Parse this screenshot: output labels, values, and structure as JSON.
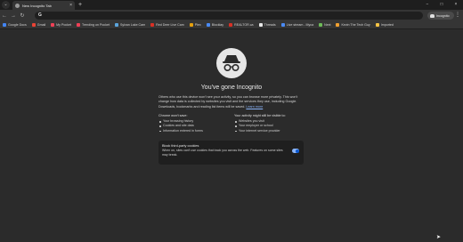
{
  "tabstrip": {
    "search_icon": "search-icon",
    "active_tab": {
      "title": "New Incognito Tab",
      "close": "×"
    },
    "new_tab": "+",
    "window_controls": [
      "−",
      "□",
      "×"
    ]
  },
  "toolbar": {
    "back": "←",
    "forward": "→",
    "reload": "↻",
    "omnibox": {
      "logo": "G",
      "value": ""
    },
    "profile_label": "Incognito",
    "menu": "⋮"
  },
  "bookmarks": [
    {
      "label": "Google Docs",
      "color": "#4285f4"
    },
    {
      "label": "Gmail",
      "color": "#ea4335"
    },
    {
      "label": "My Pocket",
      "color": "#ef4056"
    },
    {
      "label": "Trending on Pocket",
      "color": "#ef4056"
    },
    {
      "label": "Sylvan Lake Cam",
      "color": "#5ba5dd"
    },
    {
      "label": "Red Deer Live Cam",
      "color": "#d93025"
    },
    {
      "label": "Plex",
      "color": "#e5a00d"
    },
    {
      "label": "Blocklay",
      "color": "#4a8af4"
    },
    {
      "label": "REALTOR.ca",
      "color": "#d93025"
    },
    {
      "label": "Threads",
      "color": "#e8e8e8"
    },
    {
      "label": "Live stream - Myca",
      "color": "#4a8af4"
    },
    {
      "label": "Next",
      "color": "#6dbb58"
    },
    {
      "label": "Kevin The Tech Guy",
      "color": "#f0a030"
    },
    {
      "label": "Imported",
      "color": "#f6c344"
    }
  ],
  "content": {
    "title": "You've gone Incognito",
    "lead": "Others who use this device won't see your activity, so you can browse more privately. This won't change how data is collected by websites you visit and the services they use, including Google. Downloads, bookmarks and reading list items will be saved.",
    "learn_more": "Learn more",
    "wont_save": {
      "heading": "Chrome won't save:",
      "items": [
        "Your browsing history",
        "Cookies and site data",
        "Information entered in forms"
      ]
    },
    "might_see": {
      "heading": "Your activity might still be visible to:",
      "items": [
        "Websites you visit",
        "Your employer or school",
        "Your internet service provider"
      ]
    },
    "cookies": {
      "title": "Block third-party cookies",
      "description": "When on, sites can't use cookies that track you across the web. Features on some sites may break.",
      "enabled": true
    }
  },
  "colors": {
    "background": "#2b2b2b",
    "toolbar": "#353535",
    "accent": "#8ab4f8"
  }
}
